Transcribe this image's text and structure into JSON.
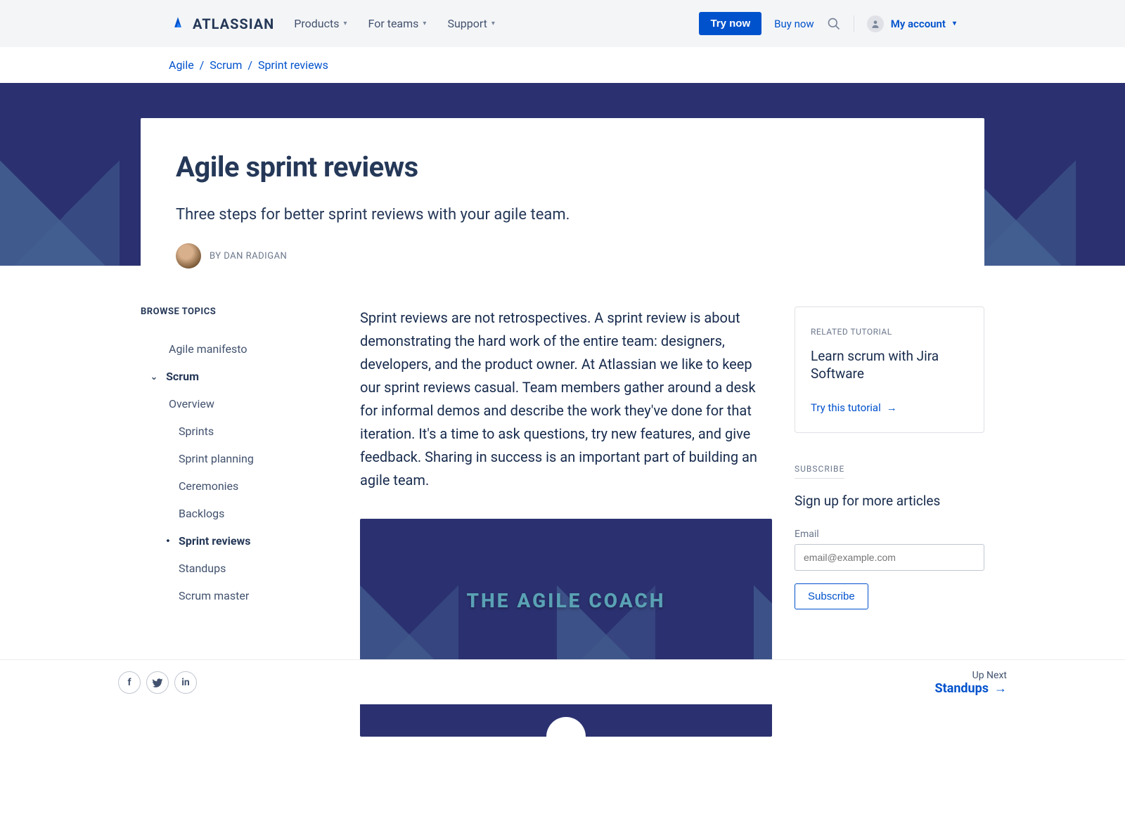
{
  "header": {
    "logo_text": "ATLASSIAN",
    "nav": [
      {
        "label": "Products"
      },
      {
        "label": "For teams"
      },
      {
        "label": "Support"
      }
    ],
    "try_label": "Try now",
    "buy_label": "Buy now",
    "account_label": "My account"
  },
  "breadcrumb": {
    "items": [
      "Agile",
      "Scrum",
      "Sprint reviews"
    ]
  },
  "hero": {
    "title": "Agile sprint reviews",
    "subtitle": "Three steps for better sprint reviews with your agile team.",
    "byline": "BY DAN RADIGAN"
  },
  "sidebar": {
    "heading": "BROWSE TOPICS",
    "items": [
      {
        "label": "Agile manifesto",
        "level": 1
      },
      {
        "label": "Scrum",
        "level": 0,
        "expandable": true
      },
      {
        "label": "Overview",
        "level": 1
      },
      {
        "label": "Sprints",
        "level": 2
      },
      {
        "label": "Sprint planning",
        "level": 2
      },
      {
        "label": "Ceremonies",
        "level": 2
      },
      {
        "label": "Backlogs",
        "level": 2
      },
      {
        "label": "Sprint reviews",
        "level": 2,
        "active": true
      },
      {
        "label": "Standups",
        "level": 2
      },
      {
        "label": "Scrum master",
        "level": 2
      }
    ]
  },
  "article": {
    "intro": "Sprint reviews are not retrospectives. A sprint review is about demonstrating the hard work of the entire team: designers, developers, and the product owner. At Atlassian we like to keep our sprint reviews casual. Team members gather around a desk for informal demos and describe the work they've done for that iteration. It's a time to ask questions, try new features, and give feedback. Sharing in success is an important part of building an agile team.",
    "video_title": "THE AGILE COACH"
  },
  "rail": {
    "related_label": "RELATED TUTORIAL",
    "related_title": "Learn scrum with Jira Software",
    "related_cta": "Try this tutorial",
    "subscribe_label": "SUBSCRIBE",
    "subscribe_title": "Sign up for more articles",
    "email_label": "Email",
    "email_placeholder": "email@example.com",
    "subscribe_button": "Subscribe"
  },
  "bottom": {
    "upnext_label": "Up Next",
    "upnext_link": "Standups"
  }
}
